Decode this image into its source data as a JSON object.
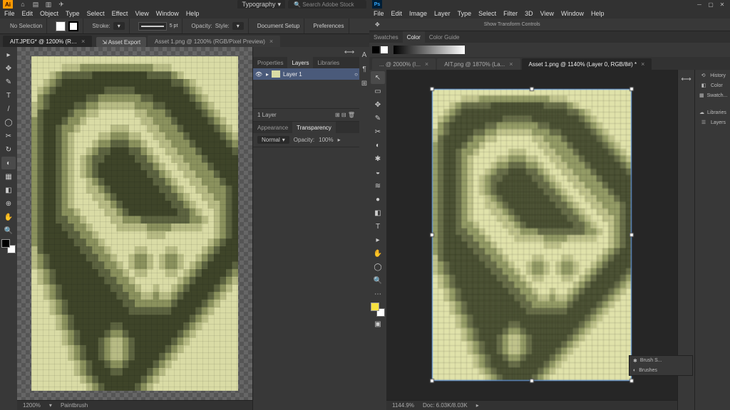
{
  "illustrator": {
    "logo": "Ai",
    "menus": [
      "File",
      "Edit",
      "Object",
      "Type",
      "Select",
      "Effect",
      "View",
      "Window",
      "Help"
    ],
    "workspace": "Typography",
    "search_placeholder": "Search Adobe Stock",
    "controlbar": {
      "selection": "No Selection",
      "stroke_label": "Stroke:",
      "stroke_bar": "5 pt",
      "opacity_label": "Opacity:",
      "style_label": "Style:",
      "doc_setup": "Document Setup",
      "preferences": "Preferences"
    },
    "tabs": [
      {
        "label": "AIT.JPEG* @ 1200% (R…",
        "active": true
      },
      {
        "label": "Asset 1.png @ 1200% (RGB/Pixel Preview)",
        "active": false
      }
    ],
    "asset_export": "Asset Export",
    "status": {
      "zoom": "1200%",
      "tool": "Paintbrush"
    },
    "panels": {
      "tabs": [
        "Properties",
        "Layers",
        "Libraries"
      ],
      "active": "Layers",
      "layer_name": "Layer 1",
      "layer_count": "1 Layer",
      "appearance_tab": "Appearance",
      "transparency_tab": "Transparency",
      "blend": "Normal",
      "opacity_label": "Opacity:",
      "opacity_val": "100%"
    },
    "tools": [
      "▸",
      "✥",
      "✎",
      "T",
      "/",
      "◯",
      "✂",
      "↻",
      "◐",
      "▦",
      "◧",
      "⊕",
      "✋",
      "🔍"
    ]
  },
  "photoshop": {
    "logo": "Ps",
    "menus": [
      "File",
      "Edit",
      "Image",
      "Layer",
      "Type",
      "Select",
      "Filter",
      "3D",
      "View",
      "Window",
      "Help"
    ],
    "top_panels": {
      "swatches": "Swatches",
      "color": "Color",
      "guide": "Color Guide"
    },
    "option_label": "Show Transform Controls",
    "tabs": [
      {
        "label": "... @ 2000% (I...",
        "active": false
      },
      {
        "label": "AIT.png @ 1870% (La...",
        "active": false
      },
      {
        "label": "Asset 1.png @ 1140% (Layer 0, RGB/8#) *",
        "active": true
      }
    ],
    "status": {
      "zoom": "1144.9%",
      "doc": "Doc: 6.03K/8.03K"
    },
    "right": {
      "history": "History",
      "color": "Color",
      "swatches": "Swatch...",
      "libraries": "Libraries",
      "layers": "Layers",
      "brush": "Brush S...",
      "brushes": "Brushes"
    },
    "tools": [
      "↖",
      "▭",
      "✥",
      "✎",
      "✂",
      "◐",
      "✱",
      "◒",
      "≋",
      "●",
      "◧",
      "T",
      "▸",
      "✋",
      "◯",
      "🔍",
      "⋯"
    ]
  },
  "portrait": {
    "w": 34,
    "h": 44,
    "palette": [
      "#d9dba5",
      "#b7bb84",
      "#8a915d",
      "#5c6340",
      "#3e4429"
    ],
    "rows": [
      "0000000000000000000000000000000000",
      "0000011122222222222211100000000000",
      "0001233333444444444333321000000000",
      "0012344444444444444444433210000000",
      "0123444444443333344444444321000000",
      "0234444443322222223344444432100000",
      "1234444332211111122233444443210000",
      "1344443221100000011222344444321000",
      "2344432210000000001122234444432100",
      "2344322100000111000112223444443210",
      "2344321000011222110011222344444321",
      "2344321000122333221001122234444432",
      "2344321001233444332100112223444443",
      "2344321012334444433210011222344444",
      "2344321012344444443321001122234444",
      "2344321012344444444332100112223444",
      "2344321001234444444433210011222344",
      "2344321001123444444443321001122234",
      "2344321000112344444444332100112234",
      "2344321000011234444444433210011234",
      "2344322100001123444444443321001234",
      "2344332210000112223333333322101234",
      "2344433221000011111222211111001234",
      "2344443322100000000111000000001234",
      "2344444332210000000000000000012344",
      "1344444433221000011000110000123444",
      "1234444443322100122101221001234444",
      "1234444444332210122101221012344443",
      "0123444444433221011000110123444432",
      "0123444444443322100000001234444321",
      "0012344444444332210010012344443210",
      "0012344444444433221121123444432100",
      "0001234444444443322222234444321000",
      "0001234444444444333333344443210000",
      "0000123444444444444444444432100000",
      "0000123444444334444444444321000000",
      "0000012344443223444444443210000000",
      "0000012344432112344444432100000000",
      "0000001234432112344444321000000000",
      "0000001234432112344443210000000000",
      "0000000123443223444432100000000000",
      "0000000123444334444321000000000000",
      "0000000012344444443210000000000000",
      "0000000001234444432100000000000000"
    ]
  }
}
